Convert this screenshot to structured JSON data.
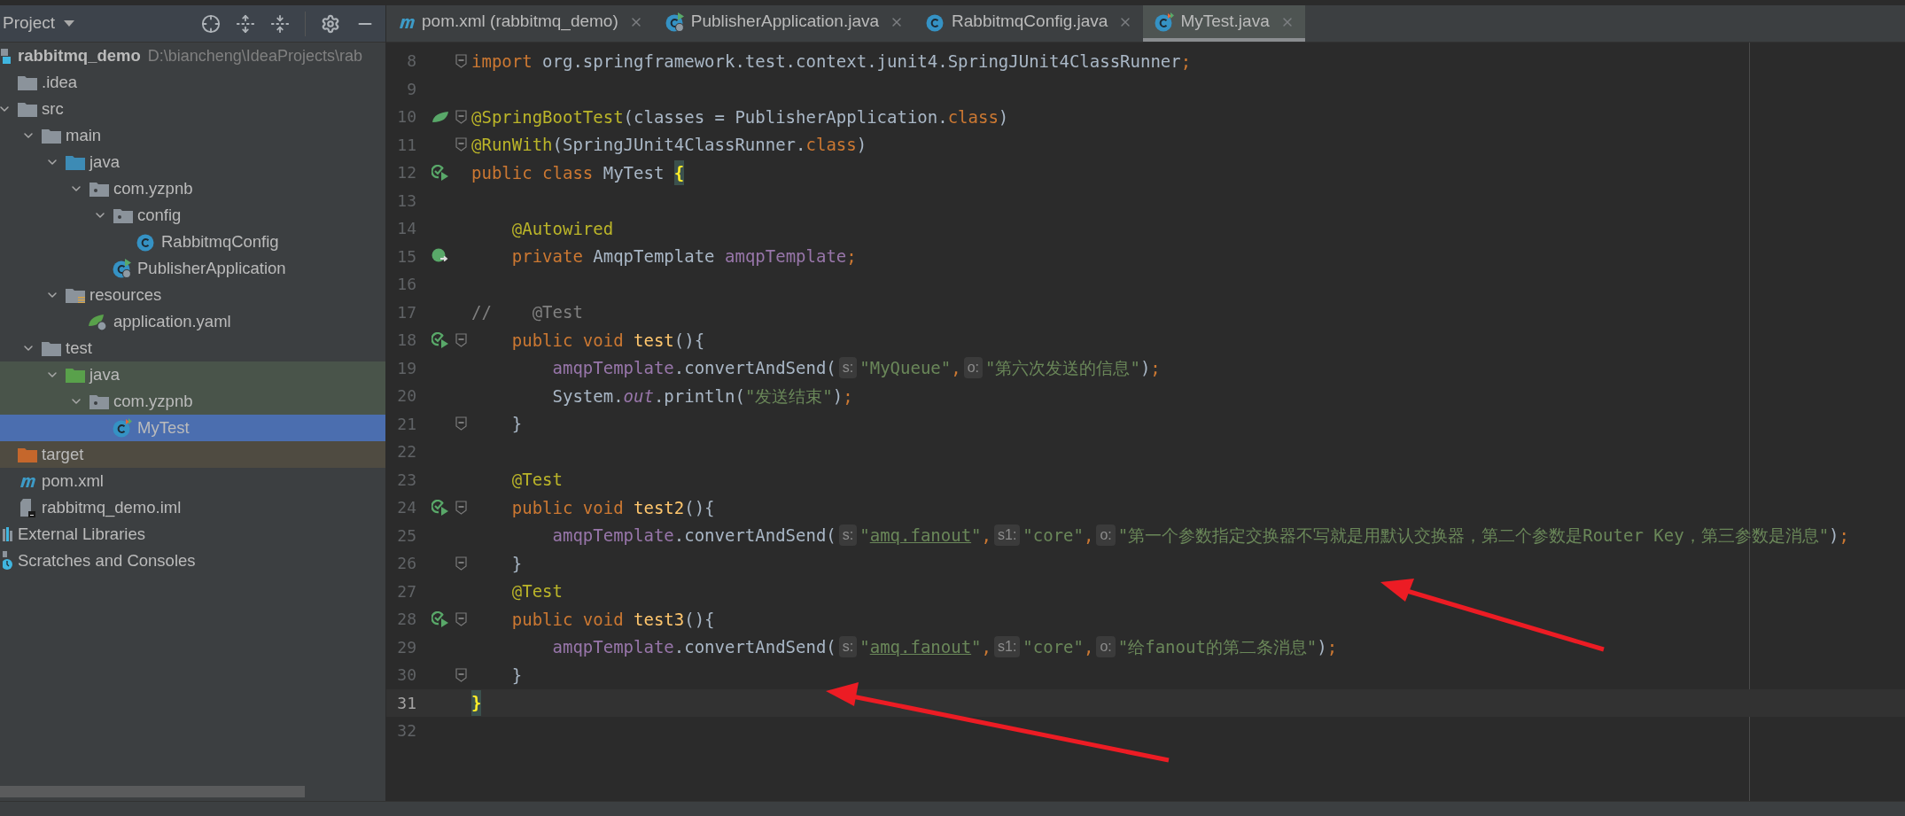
{
  "project_panel": {
    "title": "Project"
  },
  "tree": [
    {
      "label": "rabbitmq_demo",
      "path": "D:\\biancheng\\IdeaProjects\\rab",
      "kind": "module",
      "selected": false,
      "children": [
        {
          "label": ".idea",
          "kind": "folder",
          "selected": false
        },
        {
          "label": "src",
          "kind": "folder",
          "expanded": true,
          "selected": false,
          "children": [
            {
              "label": "main",
              "kind": "folder",
              "expanded": true,
              "selected": false,
              "children": [
                {
                  "label": "java",
                  "kind": "source-folder",
                  "expanded": true,
                  "selected": false,
                  "children": [
                    {
                      "label": "com.yzpnb",
                      "kind": "package",
                      "expanded": true,
                      "selected": false,
                      "children": [
                        {
                          "label": "config",
                          "kind": "package",
                          "expanded": true,
                          "selected": false,
                          "children": [
                            {
                              "label": "RabbitmqConfig",
                              "kind": "class",
                              "selected": false
                            }
                          ]
                        },
                        {
                          "label": "PublisherApplication",
                          "kind": "spring-app",
                          "selected": false
                        }
                      ]
                    }
                  ]
                },
                {
                  "label": "resources",
                  "kind": "resources-folder",
                  "expanded": true,
                  "selected": false,
                  "children": [
                    {
                      "label": "application.yaml",
                      "kind": "yaml",
                      "selected": false
                    }
                  ]
                }
              ]
            },
            {
              "label": "test",
              "kind": "folder",
              "expanded": true,
              "selected": false,
              "children": [
                {
                  "label": "java",
                  "kind": "test-folder",
                  "expanded": true,
                  "test_scope": true,
                  "selected": false,
                  "children": [
                    {
                      "label": "com.yzpnb",
                      "kind": "package",
                      "expanded": true,
                      "test_scope": true,
                      "selected": false,
                      "children": [
                        {
                          "label": "MyTest",
                          "kind": "test-class",
                          "selected": true
                        }
                      ]
                    }
                  ]
                }
              ]
            }
          ]
        },
        {
          "label": "target",
          "kind": "excluded-folder",
          "excluded": true,
          "selected": false
        },
        {
          "label": "pom.xml",
          "kind": "maven",
          "selected": false
        },
        {
          "label": "rabbitmq_demo.iml",
          "kind": "module-file",
          "selected": false
        }
      ]
    },
    {
      "label": "External Libraries",
      "kind": "libraries",
      "selected": false
    },
    {
      "label": "Scratches and Consoles",
      "kind": "scratches",
      "selected": false
    }
  ],
  "tabs": [
    {
      "label": "pom.xml (rabbitmq_demo)",
      "kind": "maven",
      "selected": false
    },
    {
      "label": "PublisherApplication.java",
      "kind": "spring-app",
      "selected": false
    },
    {
      "label": "RabbitmqConfig.java",
      "kind": "class",
      "selected": false
    },
    {
      "label": "MyTest.java",
      "kind": "test-class",
      "selected": true
    }
  ],
  "code_lines": [
    {
      "number": "8",
      "fold": true,
      "tokens": [
        {
          "text": "import",
          "kind": "keyword"
        },
        {
          "text": " org.springframework.test.context.junit4.SpringJUnit4ClassRunner",
          "kind": "plain"
        },
        {
          "text": ";",
          "kind": "keyword"
        }
      ]
    },
    {
      "number": "9"
    },
    {
      "number": "10",
      "fold": true,
      "kind": "spring",
      "tokens": [
        {
          "text": "@SpringBootTest",
          "kind": "annotation"
        },
        {
          "text": "(classes = PublisherApplication.",
          "kind": "plain"
        },
        {
          "text": "class",
          "kind": "keyword"
        },
        {
          "text": ")",
          "kind": "plain"
        }
      ]
    },
    {
      "number": "11",
      "fold": true,
      "tokens": [
        {
          "text": "@RunWith",
          "kind": "annotation"
        },
        {
          "text": "(SpringJUnit4ClassRunner.",
          "kind": "plain"
        },
        {
          "text": "class",
          "kind": "keyword"
        },
        {
          "text": ")",
          "kind": "plain"
        }
      ]
    },
    {
      "number": "12",
      "kind": "run",
      "tokens": [
        {
          "text": "public class ",
          "kind": "keyword"
        },
        {
          "text": "MyTest ",
          "kind": "plain"
        },
        {
          "text": "{",
          "kind": "brace"
        }
      ]
    },
    {
      "number": "13"
    },
    {
      "number": "14",
      "tokens": [
        {
          "text": "    @Autowired",
          "kind": "annotation"
        }
      ]
    },
    {
      "number": "15",
      "kind": "autowired",
      "tokens": [
        {
          "text": "    private ",
          "kind": "keyword"
        },
        {
          "text": "AmqpTemplate ",
          "kind": "plain"
        },
        {
          "text": "amqpTemplate",
          "kind": "field"
        },
        {
          "text": ";",
          "kind": "keyword"
        }
      ]
    },
    {
      "number": "16"
    },
    {
      "number": "17",
      "tokens": [
        {
          "text": "//    @Test",
          "kind": "comment"
        }
      ]
    },
    {
      "number": "18",
      "fold": true,
      "kind": "run",
      "tokens": [
        {
          "text": "    public void ",
          "kind": "keyword"
        },
        {
          "text": "test",
          "kind": "method"
        },
        {
          "text": "(){",
          "kind": "plain"
        }
      ]
    },
    {
      "number": "19",
      "tokens": [
        {
          "text": "        amqpTemplate",
          "kind": "field"
        },
        {
          "text": ".convertAndSend(",
          "kind": "plain"
        },
        {
          "text": "s:",
          "kind": "hint"
        },
        {
          "text": "\"MyQueue\"",
          "kind": "string"
        },
        {
          "text": ",",
          "kind": "keyword"
        },
        {
          "text": "o:",
          "kind": "hint"
        },
        {
          "text": "\"第六次发送的信息\"",
          "kind": "string"
        },
        {
          "text": ")",
          "kind": "plain"
        },
        {
          "text": ";",
          "kind": "keyword"
        }
      ]
    },
    {
      "number": "20",
      "tokens": [
        {
          "text": "        System.",
          "kind": "plain"
        },
        {
          "text": "out",
          "kind": "static"
        },
        {
          "text": ".println(",
          "kind": "plain"
        },
        {
          "text": "\"发送结束\"",
          "kind": "string"
        },
        {
          "text": ")",
          "kind": "plain"
        },
        {
          "text": ";",
          "kind": "keyword"
        }
      ]
    },
    {
      "number": "21",
      "fold": true,
      "tokens": [
        {
          "text": "    }",
          "kind": "plain"
        }
      ]
    },
    {
      "number": "22"
    },
    {
      "number": "23",
      "tokens": [
        {
          "text": "    @Test",
          "kind": "annotation"
        }
      ]
    },
    {
      "number": "24",
      "fold": true,
      "kind": "run",
      "tokens": [
        {
          "text": "    public void ",
          "kind": "keyword"
        },
        {
          "text": "test2",
          "kind": "method"
        },
        {
          "text": "(){",
          "kind": "plain"
        }
      ]
    },
    {
      "number": "25",
      "tokens": [
        {
          "text": "        amqpTemplate",
          "kind": "field"
        },
        {
          "text": ".convertAndSend(",
          "kind": "plain"
        },
        {
          "text": "s:",
          "kind": "hint"
        },
        {
          "text": "\"",
          "kind": "string"
        },
        {
          "text": "amq.fanout",
          "kind": "link"
        },
        {
          "text": "\"",
          "kind": "string"
        },
        {
          "text": ",",
          "kind": "keyword"
        },
        {
          "text": "s1:",
          "kind": "hint"
        },
        {
          "text": "\"core\"",
          "kind": "string"
        },
        {
          "text": ",",
          "kind": "keyword"
        },
        {
          "text": "o:",
          "kind": "hint"
        },
        {
          "text": "\"第一个参数指定交换器不写就是用默认交换器，第二个参数是Router Key，第三参数是消息\"",
          "kind": "string"
        },
        {
          "text": ")",
          "kind": "plain"
        },
        {
          "text": ";",
          "kind": "keyword"
        }
      ]
    },
    {
      "number": "26",
      "fold": true,
      "tokens": [
        {
          "text": "    }",
          "kind": "plain"
        }
      ]
    },
    {
      "number": "27",
      "tokens": [
        {
          "text": "    @Test",
          "kind": "annotation"
        }
      ]
    },
    {
      "number": "28",
      "fold": true,
      "kind": "run",
      "tokens": [
        {
          "text": "    public void ",
          "kind": "keyword"
        },
        {
          "text": "test3",
          "kind": "method"
        },
        {
          "text": "(){",
          "kind": "plain"
        }
      ]
    },
    {
      "number": "29",
      "tokens": [
        {
          "text": "        amqpTemplate",
          "kind": "field"
        },
        {
          "text": ".convertAndSend(",
          "kind": "plain"
        },
        {
          "text": "s:",
          "kind": "hint"
        },
        {
          "text": "\"",
          "kind": "string"
        },
        {
          "text": "amq.fanout",
          "kind": "link"
        },
        {
          "text": "\"",
          "kind": "string"
        },
        {
          "text": ",",
          "kind": "keyword"
        },
        {
          "text": "s1:",
          "kind": "hint"
        },
        {
          "text": "\"core\"",
          "kind": "string"
        },
        {
          "text": ",",
          "kind": "keyword"
        },
        {
          "text": "o:",
          "kind": "hint"
        },
        {
          "text": "\"给fanout的第二条消息\"",
          "kind": "string"
        },
        {
          "text": ")",
          "kind": "plain"
        },
        {
          "text": ";",
          "kind": "keyword"
        }
      ]
    },
    {
      "number": "30",
      "fold": true,
      "tokens": [
        {
          "text": "    }",
          "kind": "plain"
        }
      ]
    },
    {
      "number": "31",
      "current": true,
      "tokens": [
        {
          "text": "}",
          "kind": "brace"
        }
      ]
    },
    {
      "number": "32"
    }
  ]
}
